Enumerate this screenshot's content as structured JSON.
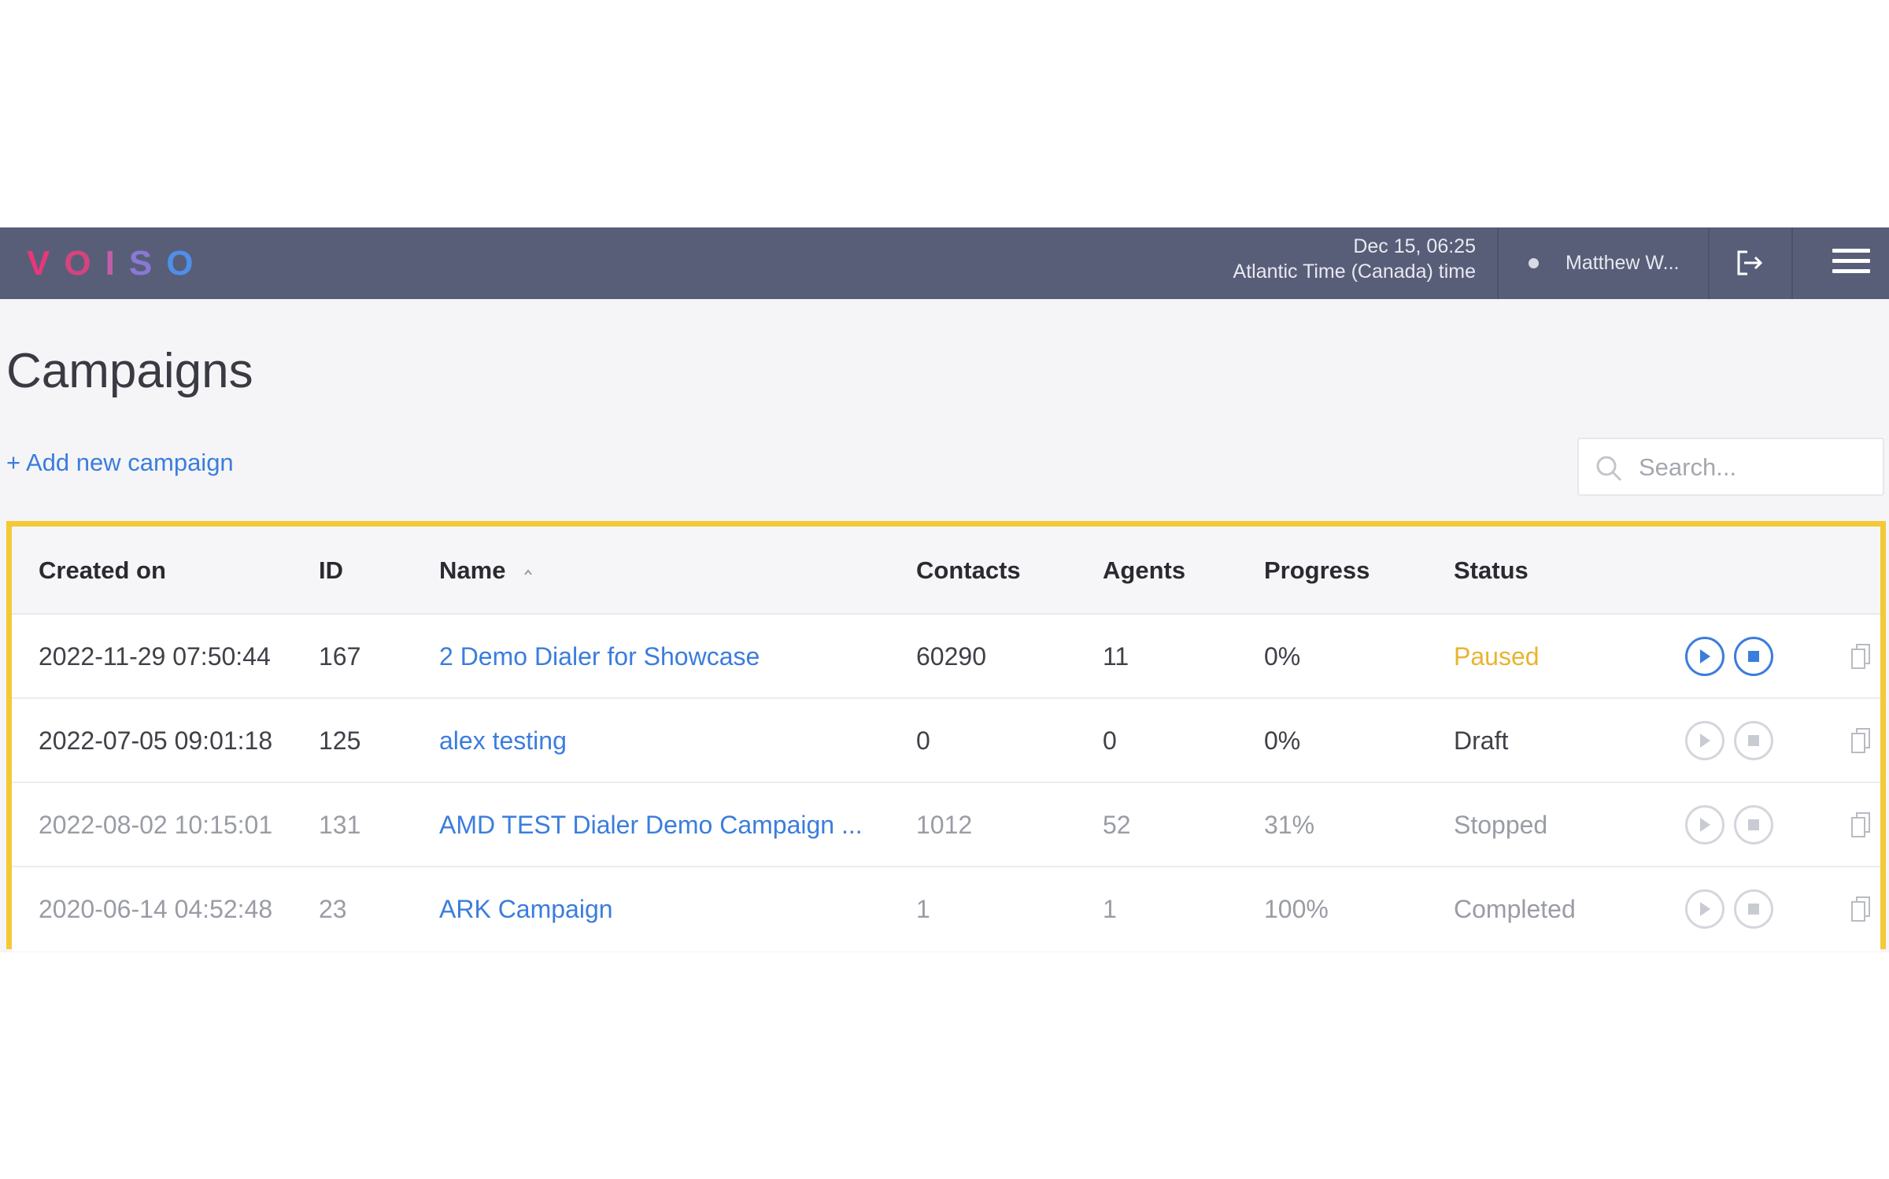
{
  "brand": {
    "logo_letters": [
      "V",
      "O",
      "I",
      "S",
      "O"
    ],
    "logo_colors": [
      "#e8377a",
      "#d6437f",
      "#c25fa6",
      "#8a78d6",
      "#4f8fea"
    ]
  },
  "header": {
    "date": "Dec 15, 06:25",
    "timezone": "Atlantic Time (Canada) time",
    "user_name": "Matthew W...",
    "bar_color": "#585e78"
  },
  "page": {
    "title": "Campaigns",
    "add_link": "+ Add new campaign",
    "search_placeholder": "Search..."
  },
  "table": {
    "columns": {
      "created_on": "Created on",
      "id": "ID",
      "name": "Name",
      "contacts": "Contacts",
      "agents": "Agents",
      "progress": "Progress",
      "status": "Status"
    },
    "sort_column": "name",
    "rows": [
      {
        "created_on": "2022-11-29 07:50:44",
        "id": "167",
        "name": "2 Demo Dialer for Showcase",
        "contacts": "60290",
        "agents": "11",
        "progress": "0%",
        "status": "Paused"
      },
      {
        "created_on": "2022-07-05 09:01:18",
        "id": "125",
        "name": "alex testing",
        "contacts": "0",
        "agents": "0",
        "progress": "0%",
        "status": "Draft"
      },
      {
        "created_on": "2022-08-02 10:15:01",
        "id": "131",
        "name": "AMD TEST Dialer Demo Campaign ...",
        "contacts": "1012",
        "agents": "52",
        "progress": "31%",
        "status": "Stopped"
      },
      {
        "created_on": "2020-06-14 04:52:48",
        "id": "23",
        "name": "ARK Campaign",
        "contacts": "1",
        "agents": "1",
        "progress": "100%",
        "status": "Completed"
      }
    ]
  },
  "colors": {
    "link": "#3b7ddd",
    "paused": "#e8b430",
    "highlight_border": "#f3c935"
  }
}
